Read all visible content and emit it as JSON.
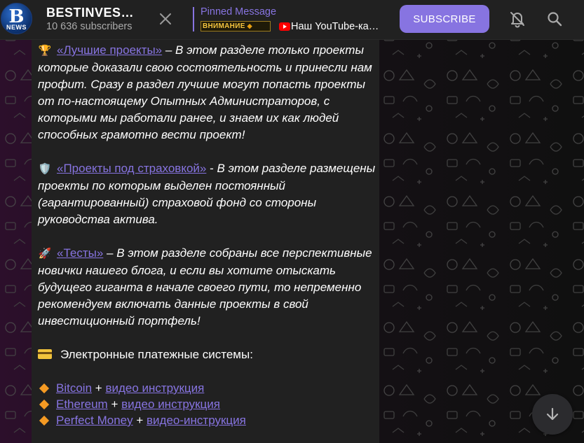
{
  "colors": {
    "accent": "#8774e1",
    "header_bg": "#212121",
    "bubble_bg": "#212121",
    "wallpaper_left": "#3a1236",
    "wallpaper_right": "#2a2a2a"
  },
  "header": {
    "channel_title": "BESTINVESTNEWS",
    "avatar_letter": "B",
    "avatar_caption": "NEWS",
    "subscribers": "10 636 subscribers",
    "close_icon": "close-icon",
    "pinned": {
      "label": "Pinned Message",
      "thumb_text": "ВНИМАНИЕ",
      "thumb_spark": "◆",
      "text": "Наш YouTube-канал"
    },
    "subscribe_label": "SUBSCRIBE",
    "mute_icon": "bell-off-icon",
    "search_icon": "search-icon"
  },
  "message": {
    "p1": {
      "emoji": "🏆",
      "link": "«Лучшие проекты»",
      "sep": " – ",
      "text": "В этом разделе только проекты которые доказали свою состоятельность и принесли нам профит. Сразу в раздел  лучшие могут попасть проекты от по-настоящему Опытных Администраторов, с которыми мы работали ранее, и знаем их как людей способных грамотно вести проект!"
    },
    "p2": {
      "emoji": "🛡️",
      "link": "«Проекты под страховкой»",
      "sep": " - ",
      "text": "В этом разделе размещены проекты по которым выделен постоянный (гарантированный) страховой фонд со стороны руководства актива."
    },
    "p3": {
      "emoji": "🚀",
      "link": "«Тесты»",
      "sep": " – ",
      "text": "В этом разделе собраны все перспективные новички нашего блога, и если вы хотите отыскать будущего гиганта в начале своего пути, то непременно рекомендуем включать данные проекты в свой инвестиционный портфель!"
    },
    "payments_heading": "Электронные платежные системы:",
    "payments": [
      {
        "name": "Bitcoin",
        "plus": "+",
        "video": "видео инструкция"
      },
      {
        "name": "Ethereum",
        "plus": "+",
        "video": "видео инструкция"
      },
      {
        "name": "Perfect Money",
        "plus": "+",
        "video": "видео-инструкция"
      }
    ]
  },
  "scroll_button_icon": "arrow-down-icon"
}
